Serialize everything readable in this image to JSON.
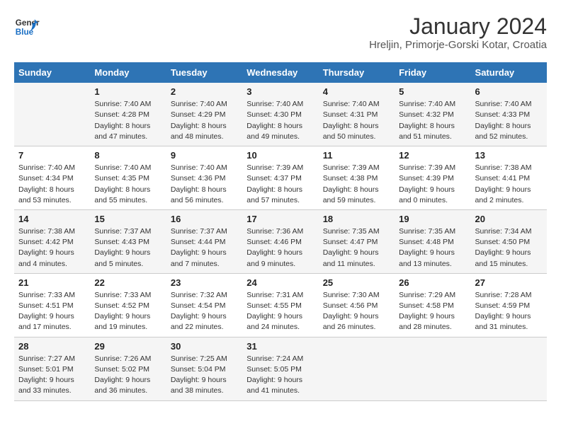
{
  "header": {
    "logo_line1": "General",
    "logo_line2": "Blue",
    "title": "January 2024",
    "subtitle": "Hreljin, Primorje-Gorski Kotar, Croatia"
  },
  "weekdays": [
    "Sunday",
    "Monday",
    "Tuesday",
    "Wednesday",
    "Thursday",
    "Friday",
    "Saturday"
  ],
  "weeks": [
    [
      {
        "day": "",
        "sunrise": "",
        "sunset": "",
        "daylight": ""
      },
      {
        "day": "1",
        "sunrise": "Sunrise: 7:40 AM",
        "sunset": "Sunset: 4:28 PM",
        "daylight": "Daylight: 8 hours and 47 minutes."
      },
      {
        "day": "2",
        "sunrise": "Sunrise: 7:40 AM",
        "sunset": "Sunset: 4:29 PM",
        "daylight": "Daylight: 8 hours and 48 minutes."
      },
      {
        "day": "3",
        "sunrise": "Sunrise: 7:40 AM",
        "sunset": "Sunset: 4:30 PM",
        "daylight": "Daylight: 8 hours and 49 minutes."
      },
      {
        "day": "4",
        "sunrise": "Sunrise: 7:40 AM",
        "sunset": "Sunset: 4:31 PM",
        "daylight": "Daylight: 8 hours and 50 minutes."
      },
      {
        "day": "5",
        "sunrise": "Sunrise: 7:40 AM",
        "sunset": "Sunset: 4:32 PM",
        "daylight": "Daylight: 8 hours and 51 minutes."
      },
      {
        "day": "6",
        "sunrise": "Sunrise: 7:40 AM",
        "sunset": "Sunset: 4:33 PM",
        "daylight": "Daylight: 8 hours and 52 minutes."
      }
    ],
    [
      {
        "day": "7",
        "sunrise": "Sunrise: 7:40 AM",
        "sunset": "Sunset: 4:34 PM",
        "daylight": "Daylight: 8 hours and 53 minutes."
      },
      {
        "day": "8",
        "sunrise": "Sunrise: 7:40 AM",
        "sunset": "Sunset: 4:35 PM",
        "daylight": "Daylight: 8 hours and 55 minutes."
      },
      {
        "day": "9",
        "sunrise": "Sunrise: 7:40 AM",
        "sunset": "Sunset: 4:36 PM",
        "daylight": "Daylight: 8 hours and 56 minutes."
      },
      {
        "day": "10",
        "sunrise": "Sunrise: 7:39 AM",
        "sunset": "Sunset: 4:37 PM",
        "daylight": "Daylight: 8 hours and 57 minutes."
      },
      {
        "day": "11",
        "sunrise": "Sunrise: 7:39 AM",
        "sunset": "Sunset: 4:38 PM",
        "daylight": "Daylight: 8 hours and 59 minutes."
      },
      {
        "day": "12",
        "sunrise": "Sunrise: 7:39 AM",
        "sunset": "Sunset: 4:39 PM",
        "daylight": "Daylight: 9 hours and 0 minutes."
      },
      {
        "day": "13",
        "sunrise": "Sunrise: 7:38 AM",
        "sunset": "Sunset: 4:41 PM",
        "daylight": "Daylight: 9 hours and 2 minutes."
      }
    ],
    [
      {
        "day": "14",
        "sunrise": "Sunrise: 7:38 AM",
        "sunset": "Sunset: 4:42 PM",
        "daylight": "Daylight: 9 hours and 4 minutes."
      },
      {
        "day": "15",
        "sunrise": "Sunrise: 7:37 AM",
        "sunset": "Sunset: 4:43 PM",
        "daylight": "Daylight: 9 hours and 5 minutes."
      },
      {
        "day": "16",
        "sunrise": "Sunrise: 7:37 AM",
        "sunset": "Sunset: 4:44 PM",
        "daylight": "Daylight: 9 hours and 7 minutes."
      },
      {
        "day": "17",
        "sunrise": "Sunrise: 7:36 AM",
        "sunset": "Sunset: 4:46 PM",
        "daylight": "Daylight: 9 hours and 9 minutes."
      },
      {
        "day": "18",
        "sunrise": "Sunrise: 7:35 AM",
        "sunset": "Sunset: 4:47 PM",
        "daylight": "Daylight: 9 hours and 11 minutes."
      },
      {
        "day": "19",
        "sunrise": "Sunrise: 7:35 AM",
        "sunset": "Sunset: 4:48 PM",
        "daylight": "Daylight: 9 hours and 13 minutes."
      },
      {
        "day": "20",
        "sunrise": "Sunrise: 7:34 AM",
        "sunset": "Sunset: 4:50 PM",
        "daylight": "Daylight: 9 hours and 15 minutes."
      }
    ],
    [
      {
        "day": "21",
        "sunrise": "Sunrise: 7:33 AM",
        "sunset": "Sunset: 4:51 PM",
        "daylight": "Daylight: 9 hours and 17 minutes."
      },
      {
        "day": "22",
        "sunrise": "Sunrise: 7:33 AM",
        "sunset": "Sunset: 4:52 PM",
        "daylight": "Daylight: 9 hours and 19 minutes."
      },
      {
        "day": "23",
        "sunrise": "Sunrise: 7:32 AM",
        "sunset": "Sunset: 4:54 PM",
        "daylight": "Daylight: 9 hours and 22 minutes."
      },
      {
        "day": "24",
        "sunrise": "Sunrise: 7:31 AM",
        "sunset": "Sunset: 4:55 PM",
        "daylight": "Daylight: 9 hours and 24 minutes."
      },
      {
        "day": "25",
        "sunrise": "Sunrise: 7:30 AM",
        "sunset": "Sunset: 4:56 PM",
        "daylight": "Daylight: 9 hours and 26 minutes."
      },
      {
        "day": "26",
        "sunrise": "Sunrise: 7:29 AM",
        "sunset": "Sunset: 4:58 PM",
        "daylight": "Daylight: 9 hours and 28 minutes."
      },
      {
        "day": "27",
        "sunrise": "Sunrise: 7:28 AM",
        "sunset": "Sunset: 4:59 PM",
        "daylight": "Daylight: 9 hours and 31 minutes."
      }
    ],
    [
      {
        "day": "28",
        "sunrise": "Sunrise: 7:27 AM",
        "sunset": "Sunset: 5:01 PM",
        "daylight": "Daylight: 9 hours and 33 minutes."
      },
      {
        "day": "29",
        "sunrise": "Sunrise: 7:26 AM",
        "sunset": "Sunset: 5:02 PM",
        "daylight": "Daylight: 9 hours and 36 minutes."
      },
      {
        "day": "30",
        "sunrise": "Sunrise: 7:25 AM",
        "sunset": "Sunset: 5:04 PM",
        "daylight": "Daylight: 9 hours and 38 minutes."
      },
      {
        "day": "31",
        "sunrise": "Sunrise: 7:24 AM",
        "sunset": "Sunset: 5:05 PM",
        "daylight": "Daylight: 9 hours and 41 minutes."
      },
      {
        "day": "",
        "sunrise": "",
        "sunset": "",
        "daylight": ""
      },
      {
        "day": "",
        "sunrise": "",
        "sunset": "",
        "daylight": ""
      },
      {
        "day": "",
        "sunrise": "",
        "sunset": "",
        "daylight": ""
      }
    ]
  ]
}
